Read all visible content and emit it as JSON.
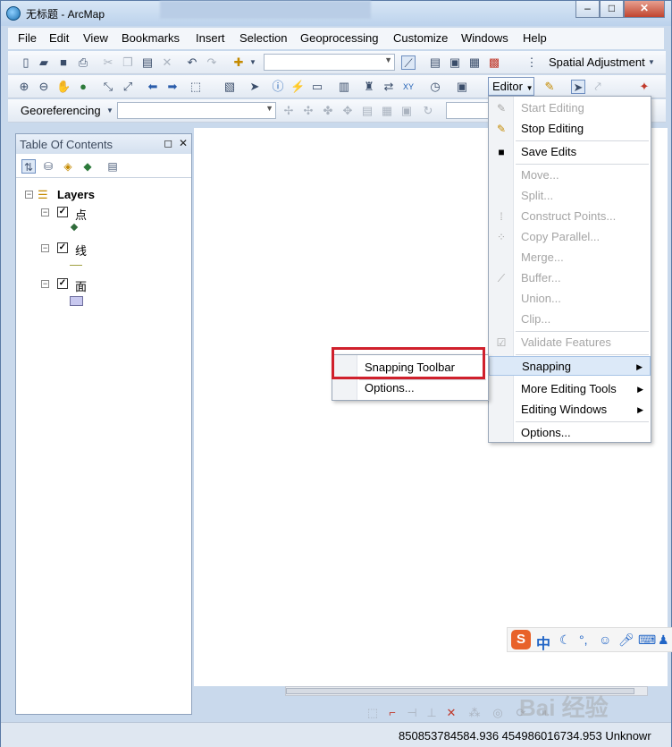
{
  "window": {
    "title": "无标题 - ArcMap",
    "minimize": "–",
    "maximize": "□",
    "close": "✕"
  },
  "menubar": [
    "File",
    "Edit",
    "View",
    "Bookmarks",
    "Insert",
    "Selection",
    "Geoprocessing",
    "Customize",
    "Windows",
    "Help"
  ],
  "toolbars": {
    "spatial_adjustment": "Spatial Adjustment",
    "editor": "Editor",
    "georeferencing": "Georeferencing"
  },
  "toc": {
    "title": "Table Of Contents",
    "root": "Layers",
    "layers": [
      {
        "name": "点",
        "checked": true
      },
      {
        "name": "线",
        "checked": true
      },
      {
        "name": "面",
        "checked": true
      }
    ]
  },
  "editor_menu": {
    "items": [
      {
        "label": "Start Editing",
        "enabled": false
      },
      {
        "label": "Stop Editing",
        "enabled": true
      },
      {
        "label": "Save Edits",
        "enabled": true
      },
      {
        "label": "Move...",
        "enabled": false
      },
      {
        "label": "Split...",
        "enabled": false
      },
      {
        "label": "Construct Points...",
        "enabled": false
      },
      {
        "label": "Copy Parallel...",
        "enabled": false
      },
      {
        "label": "Merge...",
        "enabled": false
      },
      {
        "label": "Buffer...",
        "enabled": false
      },
      {
        "label": "Union...",
        "enabled": false
      },
      {
        "label": "Clip...",
        "enabled": false
      },
      {
        "label": "Validate Features",
        "enabled": false
      },
      {
        "label": "Snapping",
        "enabled": true,
        "submenu": true
      },
      {
        "label": "More Editing Tools",
        "enabled": true,
        "submenu": true
      },
      {
        "label": "Editing Windows",
        "enabled": true,
        "submenu": true
      },
      {
        "label": "Options...",
        "enabled": true
      }
    ]
  },
  "snapping_submenu": {
    "items": [
      {
        "label": "Snapping Toolbar"
      },
      {
        "label": "Options..."
      }
    ]
  },
  "ime": {
    "logo": "S",
    "mode": "中"
  },
  "status": {
    "coordinates": "850853784584.936  454986016734.953 Unknowr"
  },
  "watermark": "Bai 经验",
  "colors": {
    "highlight": "#d0202c",
    "accent": "#2165c6"
  }
}
